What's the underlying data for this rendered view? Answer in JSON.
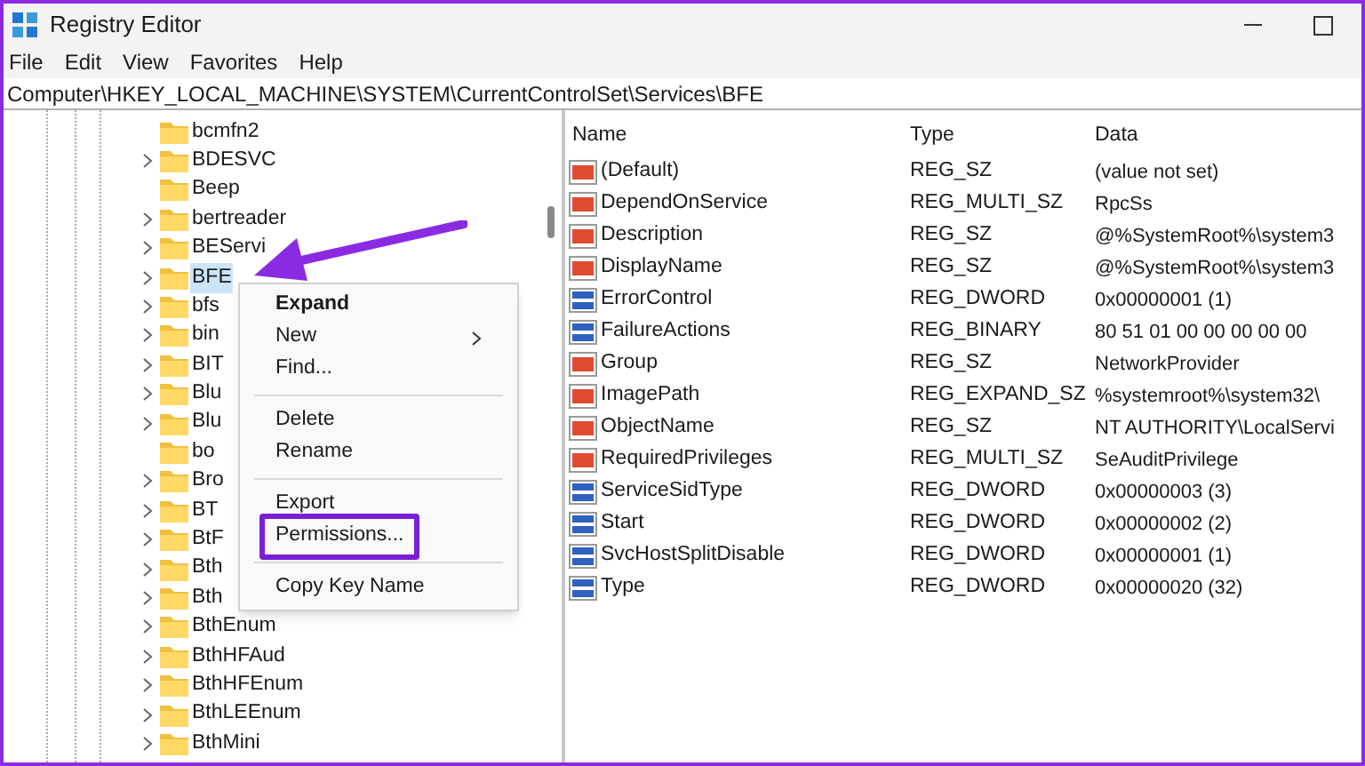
{
  "window": {
    "title": "Registry Editor"
  },
  "menu": [
    "File",
    "Edit",
    "View",
    "Favorites",
    "Help"
  ],
  "address": "Computer\\HKEY_LOCAL_MACHINE\\SYSTEM\\CurrentControlSet\\Services\\BFE",
  "tree": [
    {
      "label": "bcmfn2",
      "expandable": false,
      "selected": false
    },
    {
      "label": "BDESVC",
      "expandable": true,
      "selected": false
    },
    {
      "label": "Beep",
      "expandable": false,
      "selected": false
    },
    {
      "label": "bertreader",
      "expandable": true,
      "selected": false
    },
    {
      "label": "BEServi",
      "expandable": true,
      "selected": false
    },
    {
      "label": "BFE",
      "expandable": true,
      "selected": true
    },
    {
      "label": "bfs",
      "expandable": true,
      "selected": false
    },
    {
      "label": "bin",
      "expandable": true,
      "selected": false
    },
    {
      "label": "BIT",
      "expandable": true,
      "selected": false
    },
    {
      "label": "Blu",
      "expandable": true,
      "selected": false
    },
    {
      "label": "Blu",
      "expandable": true,
      "selected": false
    },
    {
      "label": "bo",
      "expandable": false,
      "selected": false
    },
    {
      "label": "Bro",
      "expandable": true,
      "selected": false
    },
    {
      "label": "BT",
      "expandable": true,
      "selected": false
    },
    {
      "label": "BtF",
      "expandable": true,
      "selected": false
    },
    {
      "label": "Bth",
      "expandable": true,
      "selected": false
    },
    {
      "label": "Bth",
      "expandable": true,
      "selected": false
    },
    {
      "label": "BthEnum",
      "expandable": true,
      "selected": false
    },
    {
      "label": "BthHFAud",
      "expandable": true,
      "selected": false
    },
    {
      "label": "BthHFEnum",
      "expandable": true,
      "selected": false
    },
    {
      "label": "BthLEEnum",
      "expandable": true,
      "selected": false
    },
    {
      "label": "BthMini",
      "expandable": true,
      "selected": false
    }
  ],
  "context_menu": [
    {
      "kind": "item",
      "label": "Expand",
      "bold": true,
      "submenu": false,
      "highlighted": false
    },
    {
      "kind": "item",
      "label": "New",
      "bold": false,
      "submenu": true,
      "highlighted": false
    },
    {
      "kind": "item",
      "label": "Find...",
      "bold": false,
      "submenu": false,
      "highlighted": false
    },
    {
      "kind": "separator"
    },
    {
      "kind": "item",
      "label": "Delete",
      "bold": false,
      "submenu": false,
      "highlighted": false
    },
    {
      "kind": "item",
      "label": "Rename",
      "bold": false,
      "submenu": false,
      "highlighted": false
    },
    {
      "kind": "separator"
    },
    {
      "kind": "item",
      "label": "Export",
      "bold": false,
      "submenu": false,
      "highlighted": false
    },
    {
      "kind": "item",
      "label": "Permissions...",
      "bold": false,
      "submenu": false,
      "highlighted": true
    },
    {
      "kind": "separator"
    },
    {
      "kind": "item",
      "label": "Copy Key Name",
      "bold": false,
      "submenu": false,
      "highlighted": false
    }
  ],
  "table": {
    "columns": [
      "Name",
      "Type",
      "Data"
    ],
    "rows": [
      {
        "kind": "string",
        "name": "(Default)",
        "type": "REG_SZ",
        "data": "(value not set)"
      },
      {
        "kind": "string",
        "name": "DependOnService",
        "type": "REG_MULTI_SZ",
        "data": "RpcSs"
      },
      {
        "kind": "string",
        "name": "Description",
        "type": "REG_SZ",
        "data": "@%SystemRoot%\\system3"
      },
      {
        "kind": "string",
        "name": "DisplayName",
        "type": "REG_SZ",
        "data": "@%SystemRoot%\\system3"
      },
      {
        "kind": "binary",
        "name": "ErrorControl",
        "type": "REG_DWORD",
        "data": "0x00000001 (1)"
      },
      {
        "kind": "binary",
        "name": "FailureActions",
        "type": "REG_BINARY",
        "data": "80 51 01 00 00 00 00 00"
      },
      {
        "kind": "string",
        "name": "Group",
        "type": "REG_SZ",
        "data": "NetworkProvider"
      },
      {
        "kind": "string",
        "name": "ImagePath",
        "type": "REG_EXPAND_SZ",
        "data": "%systemroot%\\system32\\"
      },
      {
        "kind": "string",
        "name": "ObjectName",
        "type": "REG_SZ",
        "data": "NT AUTHORITY\\LocalServi"
      },
      {
        "kind": "string",
        "name": "RequiredPrivileges",
        "type": "REG_MULTI_SZ",
        "data": "SeAuditPrivilege"
      },
      {
        "kind": "binary",
        "name": "ServiceSidType",
        "type": "REG_DWORD",
        "data": "0x00000003 (3)"
      },
      {
        "kind": "binary",
        "name": "Start",
        "type": "REG_DWORD",
        "data": "0x00000002 (2)"
      },
      {
        "kind": "binary",
        "name": "SvcHostSplitDisable",
        "type": "REG_DWORD",
        "data": "0x00000001 (1)"
      },
      {
        "kind": "binary",
        "name": "Type",
        "type": "REG_DWORD",
        "data": "0x00000020 (32)"
      }
    ]
  }
}
